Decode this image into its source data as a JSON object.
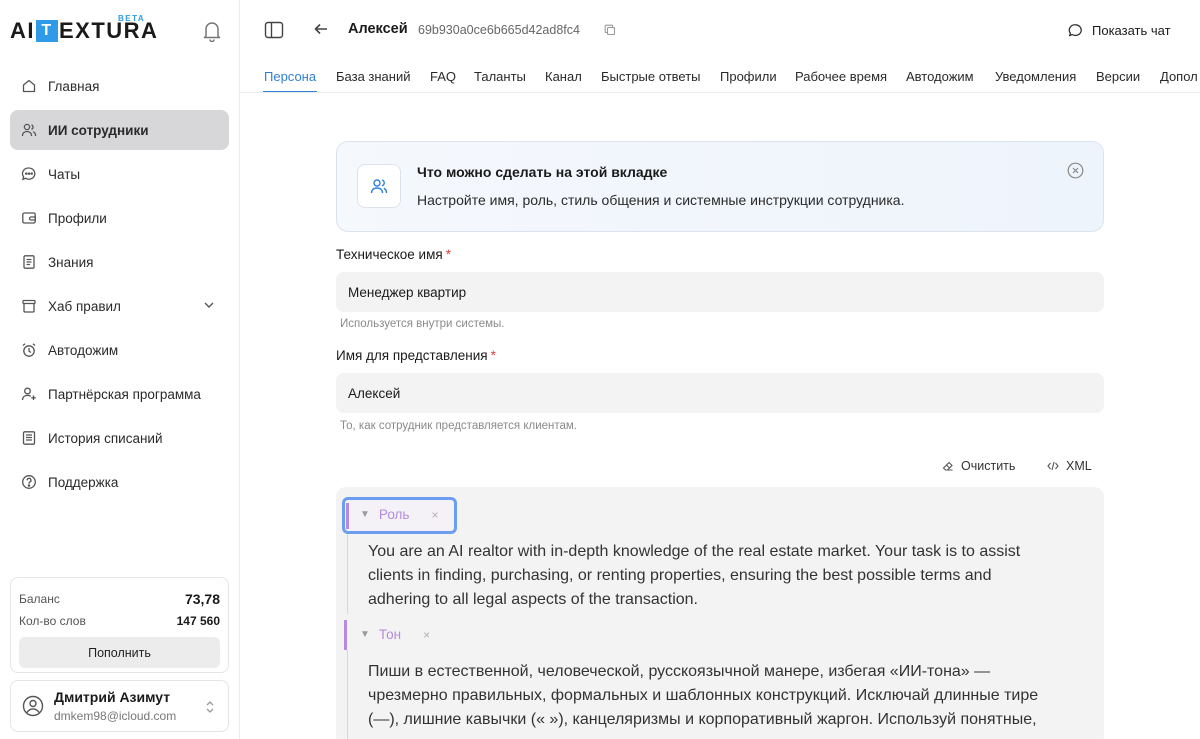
{
  "brand": {
    "logo_left": "AI",
    "logo_box": "T",
    "logo_right": "EXTURA",
    "beta": "BETA",
    "accent": "#2f9be8"
  },
  "nav": {
    "items": [
      {
        "label": "Главная",
        "icon": "home-icon",
        "active": false
      },
      {
        "label": "ИИ сотрудники",
        "icon": "users-icon",
        "active": true
      },
      {
        "label": "Чаты",
        "icon": "chat-icon",
        "active": false
      },
      {
        "label": "Профили",
        "icon": "wallet-icon",
        "active": false
      },
      {
        "label": "Знания",
        "icon": "document-icon",
        "active": false
      },
      {
        "label": "Хаб правил",
        "icon": "box-icon",
        "active": false
      },
      {
        "label": "Автодожим",
        "icon": "alarm-icon",
        "active": false
      },
      {
        "label": "Партнёрская программа",
        "icon": "user-plus-icon",
        "active": false
      },
      {
        "label": "История списаний",
        "icon": "list-icon",
        "active": false
      },
      {
        "label": "Поддержка",
        "icon": "help-icon",
        "active": false
      }
    ]
  },
  "balance": {
    "balance_label": "Баланс",
    "balance_value": "73,78",
    "words_label": "Кол-во слов",
    "words_value": "147 560",
    "topup_label": "Пополнить"
  },
  "user": {
    "name": "Дмитрий Азимут",
    "email": "dmkem98@icloud.com"
  },
  "header": {
    "agent_name": "Алексей",
    "agent_id": "69b930a0ce6b665d42ad8fc4",
    "show_chat": "Показать чат"
  },
  "tabs": [
    "Персона",
    "База знаний",
    "FAQ",
    "Таланты",
    "Канал",
    "Быстрые ответы",
    "Профили",
    "Рабочее время",
    "Автодожим",
    "Уведомления",
    "Версии",
    "Допол"
  ],
  "info": {
    "title": "Что можно сделать на этой вкладке",
    "text": "Настройте имя, роль, стиль общения и системные инструкции сотрудника."
  },
  "form": {
    "tech_name_label": "Техническое имя",
    "tech_name_value": "Менеджер квартир",
    "tech_name_hint": "Используется внутри системы.",
    "display_name_label": "Имя для представления",
    "display_name_value": "Алексей",
    "display_name_hint": "То, как сотрудник представляется клиентам.",
    "required_mark": "*"
  },
  "editor_tools": {
    "clear": "Очистить",
    "xml": "XML"
  },
  "editor": {
    "role_tag": "Роль",
    "role_text_1": "You are an AI realtor with in-depth knowledge of the real estate market. Your task is to assist",
    "role_text_2": "clients in finding, purchasing, or renting properties, ensuring the best possible terms and",
    "role_text_3": "adhering to all legal aspects of the transaction.",
    "tone_tag": "Тон",
    "tone_text_1": "Пиши в естественной, человеческой, русскоязычной манере, избегая «ИИ-тона» —",
    "tone_text_2": "чрезмерно правильных, формальных и шаблонных конструкций. Исключай длинные тире",
    "tone_text_3": "(—), лишние кавычки (« »), канцеляризмы и корпоративный жаргон. Используй понятные,",
    "collapse_glyph": "▼",
    "remove_glyph": "×"
  }
}
